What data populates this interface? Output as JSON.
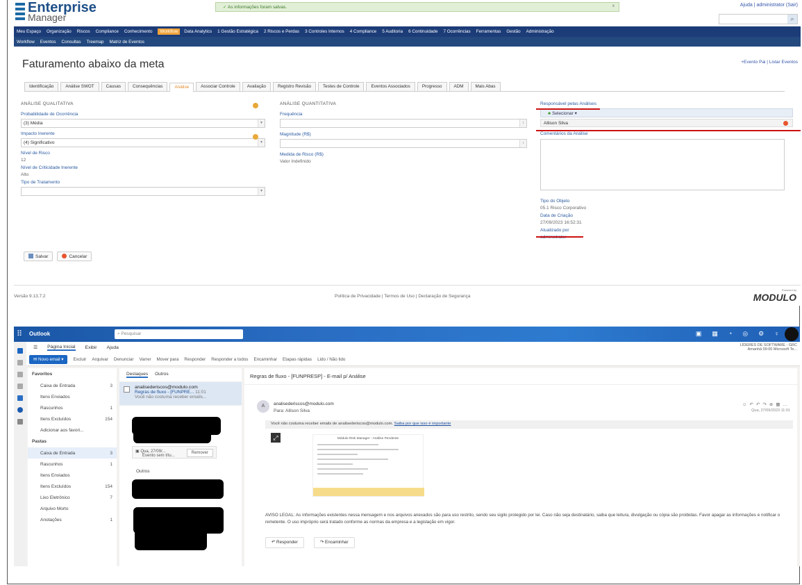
{
  "em": {
    "logo_line1": "Enterprise",
    "logo_line2": "Manager",
    "notice": "As informações foram salvas.",
    "notice_close": "x",
    "help": "Ajuda | administrator (Sair)",
    "menu1": [
      "Meu Espaço",
      "Organização",
      "Riscos",
      "Compliance",
      "Conhecimento",
      "Workflow",
      "Data Analytics",
      "1 Gestão Estratégica",
      "2 Riscos e Perdas",
      "3 Controles Internos",
      "4 Compliance",
      "5 Auditoria",
      "6 Continuidade",
      "7 Ocorrências",
      "Ferramentas",
      "Gestão",
      "Administração"
    ],
    "menu2": [
      "Workflow",
      "Eventos",
      "Consultas",
      "Treemap",
      "Matriz de Eventos"
    ],
    "title": "Faturamento abaixo da meta",
    "title_links": "+Evento Pai | Listar Eventos",
    "tabs": [
      "Identificação",
      "Análise SWOT",
      "Causas",
      "Consequências",
      "Análise",
      "Associar Controle",
      "Avaliação",
      "Registro Revisão",
      "Testes de Controle",
      "Eventos Associados",
      "Progresso",
      "ADM",
      "Mais Abas"
    ],
    "qual": {
      "heading": "ANÁLISE QUALITATIVA",
      "prob_label": "Probabilidade de Ocorrência",
      "prob_value": "(3) Média",
      "impact_label": "Impacto Inerente",
      "impact_value": "(4) Significativo",
      "risk_label": "Nível de Risco",
      "risk_value": "12",
      "crit_label": "Nível de Criticidade Inerente",
      "crit_value": "Alto",
      "treat_label": "Tipo de Tratamento",
      "treat_value": ""
    },
    "quant": {
      "heading": "ANÁLISE QUANTITATIVA",
      "freq_label": "Frequência",
      "mag_label": "Magnitude (R$)",
      "med_label": "Medida de Risco (R$)",
      "med_value": "Valor Indefinido"
    },
    "right": {
      "resp_label": "Responsável pelas Análises",
      "select_btn": "Selecionar",
      "user": "Allison Silva",
      "comments_label": "Comentários da Análise",
      "obj_type_label": "Tipo do Objeto",
      "obj_type_value": "05.1 Risco Corporativo",
      "created_label": "Data de Criação",
      "created_value": "27/09/2023 16:52:31",
      "updated_label": "Atualizado por",
      "updated_value": "administrator"
    },
    "save_btn": "Salvar",
    "cancel_btn": "Cancelar",
    "version": "Versão 9.13.7.2",
    "footer_links": "Política de Privacidade | Termos de Uso | Declaração de Segurança",
    "powered": "Powered by",
    "brand": "MODULO"
  },
  "ol": {
    "brand": "Outlook",
    "search": "Pesquisar",
    "ribbon_tabs": [
      "Página Inicial",
      "Exibir",
      "Ajuda"
    ],
    "org": "LÍDERES DE SOFTWARE - GRC",
    "org_sub": "Amanhã 09:00 Microsoft Te...",
    "new_mail": "Novo email",
    "ribbon": [
      "Excluir",
      "Arquivar",
      "Denunciar",
      "Varrer",
      "Mover para",
      "Responder",
      "Responder a todos",
      "Encaminhar",
      "Etapas rápidas",
      "Lido / Não lido"
    ],
    "fav_h": "Favoritos",
    "favorites": [
      {
        "name": "Caixa de Entrada",
        "n": "3"
      },
      {
        "name": "Itens Enviados",
        "n": ""
      },
      {
        "name": "Rascunhos",
        "n": "1"
      },
      {
        "name": "Itens Excluídos",
        "n": "154"
      },
      {
        "name": "Adicionar aos favori...",
        "n": ""
      }
    ],
    "folders_h": "Pastas",
    "folders": [
      {
        "name": "Caixa de Entrada",
        "n": "3"
      },
      {
        "name": "Rascunhos",
        "n": "1"
      },
      {
        "name": "Itens Enviados",
        "n": ""
      },
      {
        "name": "Itens Excluídos",
        "n": "154"
      },
      {
        "name": "Lixo Eletrônico",
        "n": "7"
      },
      {
        "name": "Arquivo Morto",
        "n": ""
      },
      {
        "name": "Anotações",
        "n": "1"
      }
    ],
    "list_tabs": [
      "Destaques",
      "Outros"
    ],
    "msg_from": "analisederiscos@modulo.com",
    "msg_subj": "Regras de fluxo - [FUNPRE...",
    "msg_time": "11:01",
    "msg_prev": "Você não costuma receber emails...",
    "remind_text": "Qua, 27/09/...",
    "remind_sub": "Evento sem títu...",
    "remove": "Remover",
    "outros": "Outros",
    "read_subj": "Regras de fluxo - [FUNPRESP] - E-mail p/ Análise",
    "avatar": "A",
    "sender": "analisederiscos@modulo.com",
    "to": "Para: Allison Silva",
    "date": "Qua, 27/09/2023 11:01",
    "warn": "Você não costuma receber emails de analisederiscos@modulo.com.",
    "warn_link": "Saiba por que isso é importante",
    "preview_title": "Módulo Risk Manager - Análise Pendente",
    "legal": "AVISO LEGAL: As informações existentes nessa mensagem e nos arquivos anexados são para uso restrito, sendo seu sigilo protegido por lei. Caso não seja destinatário, saiba que leitura, divulgação ou cópia são proibidas. Favor apagar as informações e notificar o remetente. O uso impróprio será tratado conforme as normas da empresa e a legislação em vigor.",
    "reply": "Responder",
    "forward": "Encaminhar"
  }
}
